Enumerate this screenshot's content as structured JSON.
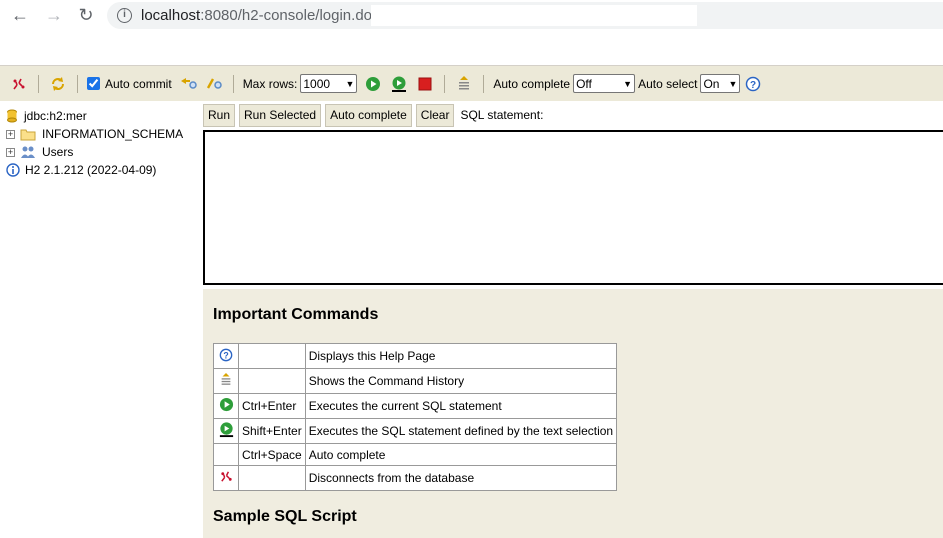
{
  "browser": {
    "url_host": "localhost",
    "url_path": ":8080/h2-console/login.do?"
  },
  "toolbar": {
    "auto_commit_label": "Auto commit",
    "auto_commit_checked": true,
    "max_rows_label": "Max rows:",
    "max_rows_value": "1000",
    "auto_complete_label": "Auto complete",
    "auto_complete_value": "Off",
    "auto_select_label": "Auto select",
    "auto_select_value": "On",
    "icons": [
      "disconnect-icon",
      "refresh-icon",
      "rollback-icon",
      "commit-icon",
      "run-icon",
      "run-selected-icon",
      "stop-icon",
      "history-icon",
      "help-icon"
    ]
  },
  "tree": {
    "connection": "jdbc:h2:mer",
    "schema": "INFORMATION_SCHEMA",
    "users": "Users",
    "version": "H2 2.1.212 (2022-04-09)"
  },
  "query": {
    "run_label": "Run",
    "run_selected_label": "Run Selected",
    "auto_complete_label": "Auto complete",
    "clear_label": "Clear",
    "sql_statement_label": "SQL statement:",
    "sql_text": ""
  },
  "help": {
    "important_title": "Important Commands",
    "commands": [
      {
        "icon": "help-icon",
        "key": "",
        "desc": "Displays this Help Page"
      },
      {
        "icon": "history-icon",
        "key": "",
        "desc": "Shows the Command History"
      },
      {
        "icon": "run-icon",
        "key": "Ctrl+Enter",
        "desc": "Executes the current SQL statement"
      },
      {
        "icon": "run-selected-icon",
        "key": "Shift+Enter",
        "desc": "Executes the SQL statement defined by the text selection"
      },
      {
        "icon": "",
        "key": "Ctrl+Space",
        "desc": "Auto complete"
      },
      {
        "icon": "disconnect-icon",
        "key": "",
        "desc": "Disconnects from the database"
      }
    ],
    "sample_title": "Sample SQL Script"
  },
  "colors": {
    "toolbar_bg": "#ece9d8",
    "help_bg": "#f0ede0",
    "run_green": "#2e9e3a",
    "stop_red": "#d81f1f"
  }
}
